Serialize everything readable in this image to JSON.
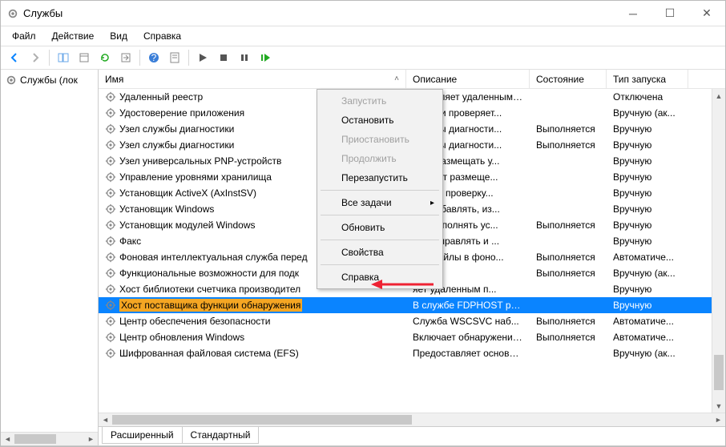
{
  "title": "Службы",
  "menus": {
    "file": "Файл",
    "action": "Действие",
    "view": "Вид",
    "help": "Справка"
  },
  "side": {
    "node": "Службы (лок"
  },
  "columns": {
    "name": "Имя",
    "desc": "Описание",
    "state": "Состояние",
    "startup": "Тип запуска"
  },
  "services": [
    {
      "name": "Удаленный реестр",
      "desc": "Позволяет удаленным п...",
      "state": "",
      "startup": "Отключена"
    },
    {
      "name": "Удостоверение приложения",
      "desc": "еляет и проверяет...",
      "state": "",
      "startup": "Вручную (ак..."
    },
    {
      "name": "Узел службы диагностики",
      "desc": "истемы диагности...",
      "state": "Выполняется",
      "startup": "Вручную"
    },
    {
      "name": "Узел службы диагностики",
      "desc": "истемы диагности...",
      "state": "Выполняется",
      "startup": "Вручную"
    },
    {
      "name": "Узел универсальных PNP-устройств",
      "desc": "ляет размещать у...",
      "state": "",
      "startup": "Вручную"
    },
    {
      "name": "Управление уровнями хранилища",
      "desc": "изирует размеще...",
      "state": "",
      "startup": "Вручную"
    },
    {
      "name": "Установщик ActiveX (AxInstSV)",
      "desc": "чивает проверку...",
      "state": "",
      "startup": "Вручную"
    },
    {
      "name": "Установщик Windows",
      "desc": "яет добавлять, из...",
      "state": "",
      "startup": "Вручную"
    },
    {
      "name": "Установщик модулей Windows",
      "desc": "яет выполнять ус...",
      "state": "Выполняется",
      "startup": "Вручную"
    },
    {
      "name": "Факс",
      "desc": "яет отправлять и ...",
      "state": "",
      "startup": "Вручную"
    },
    {
      "name": "Фоновая интеллектуальная служба перед",
      "desc": "ает файлы в фоно...",
      "state": "Выполняется",
      "startup": "Автоматиче..."
    },
    {
      "name": "Функциональные возможности для подк",
      "desc": "",
      "state": "Выполняется",
      "startup": "Вручную (ак..."
    },
    {
      "name": "Хост библиотеки счетчика производител",
      "desc": "яет удаленным п...",
      "state": "",
      "startup": "Вручную"
    },
    {
      "name": "Хост поставщика функции обнаружения",
      "desc": "В службе FDPHOST разм...",
      "state": "",
      "startup": "Вручную",
      "selected": true
    },
    {
      "name": "Центр обеспечения безопасности",
      "desc": "Служба WSCSVC наб...",
      "state": "Выполняется",
      "startup": "Автоматиче..."
    },
    {
      "name": "Центр обновления Windows",
      "desc": "Включает обнаружение,...",
      "state": "Выполняется",
      "startup": "Автоматиче..."
    },
    {
      "name": "Шифрованная файловая система (EFS)",
      "desc": "Предоставляет основну...",
      "state": "",
      "startup": "Вручную (ак..."
    }
  ],
  "tabs": {
    "extended": "Расширенный",
    "standard": "Стандартный"
  },
  "context": {
    "start": "Запустить",
    "stop": "Остановить",
    "pause": "Приостановить",
    "resume": "Продолжить",
    "restart": "Перезапустить",
    "all_tasks": "Все задачи",
    "refresh": "Обновить",
    "properties": "Свойства",
    "help": "Справка"
  }
}
